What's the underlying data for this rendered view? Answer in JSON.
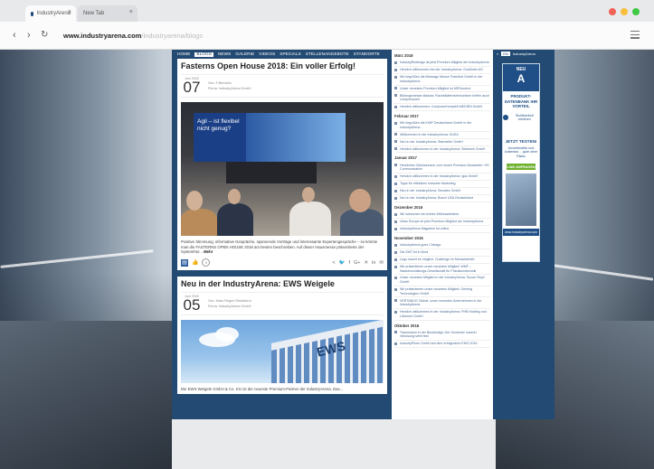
{
  "browser": {
    "tabs": [
      {
        "label": "IndustryArena"
      },
      {
        "label": "New Tab"
      }
    ],
    "tab_close_glyph": "×",
    "window_buttons": [
      {
        "name": "close",
        "color": "#f26155"
      },
      {
        "name": "minimize",
        "color": "#f9be3a"
      },
      {
        "name": "maximize",
        "color": "#3ec945"
      }
    ],
    "nav": {
      "back": "‹",
      "forward": "›",
      "reload": "↻"
    },
    "url_host": "www.industryarena.com",
    "url_path": "/industryarena/blogs",
    "menu_icon": "hamburger-menu-icon"
  },
  "site_nav": [
    "HOME",
    "BLOGS",
    "NEWS",
    "GALERIE",
    "VIDEOS",
    "SPECIALS",
    "STELLENANGEBOTE",
    "STANDORTE"
  ],
  "site_nav_active": "BLOGS",
  "posts": [
    {
      "title": "Fasterns Open House 2018: Ein voller Erfolg!",
      "month": "Juni 2018",
      "day": "07",
      "author": "Von: F.Bertoldo",
      "company": "Firma: IndustryArena GmbH",
      "slide_text": "Agil – ist flexibel nicht genug?",
      "excerpt": "Positive Stimmung, informative Gespräche, spannende Vorträge und interessante Expertengespräche – so könnte man die FASTERNS OPEN HOUSE 2018 am besten beschreiben. Auf dieser Hausmesse präsentierte der Systemher...",
      "more": "Mehr"
    },
    {
      "title": "Neu in der IndustryArena: EWS Weigele",
      "month": "Juni 2018",
      "day": "05",
      "author": "Von: Mark Regen Redakteur",
      "company": "Firma: IndustryArena GmbH",
      "image_text": "EWS",
      "excerpt": "Die EWS Weigele GmbH & Co. KG ist der neueste Premium-Partner der IndustryArena. Das..."
    }
  ],
  "share_icons": [
    "share-icon",
    "twitter-icon",
    "facebook-icon",
    "google-plus-icon",
    "xing-icon",
    "linkedin-icon",
    "email-icon"
  ],
  "share_glyphs": [
    "<",
    "🐦",
    "f",
    "G+",
    "✕",
    "in",
    "✉"
  ],
  "post_action_glyphs": {
    "comment": "▤",
    "like": "👍",
    "comment_count": "0"
  },
  "archive": [
    {
      "month": "März 2018",
      "items": [
        "IndustryRedesign ist jetzt Premium-Mitglied der IndustryArena",
        "Herzlich willkommen bei der IndustryArena: Goldhofer AG",
        "Wir begrüßen die Messago Messe Frankfurt GmbH in der IndustryArena",
        "Unser neuestes Premium-Mitglied ist MEScontrol",
        "Bildungsmesse didacta: Flachbildfernsehmonitore helfen auch Lehrpersonen",
        "Herzlich willkommen: ComputerKomplett MEDIEN GmbH"
      ]
    },
    {
      "month": "Februar 2017",
      "items": [
        "Wir begrüßen die KNIP Deutschland GmbH in der IndustryArena",
        "Willkommen in der IndustryArena: KUKA",
        "Neu in der IndustryArena: Starrseiler GmbH",
        "Herzlich willkommen in der IndustryArena: Steinbeis GmbH"
      ]
    },
    {
      "month": "Januar 2017",
      "items": [
        "Herzliches Glückwunsch zum neuen Premium-Newsletter: HS Communication",
        "Herzlich willkommen in der IndustryArena: igus GmbH",
        "Tipps für effektives Industrie Marketing",
        "Neu in der IndustryArena: Sensitec GmbH",
        "Neu in der IndustryArena: Bosch USA Deutschland"
      ]
    },
    {
      "month": "Dezember 2016",
      "items": [
        "Wir wünschen ein frohes Weihnachtsfest",
        "Ulvac Europe ist jetzt Premium-Mitglied der IndustryArena",
        "IndustryArena-Magazine ist online"
      ]
    },
    {
      "month": "November 2016",
      "items": [
        "IndustryArena goes Chicago",
        "Die DMT ist in Bord",
        "Lego macht es möglich: Challenge im Messebetrieb",
        "Wir präsentieren unser neuestes Mitglied: WMF – Wasserschaltungs-Gesellschaft für Präzisionstechnik",
        "Unser neuestes Mitglied in der IndustryArena: Suzan Reyd GmbH",
        "Wir präsentieren unser neuestes Mitglied: Gehring Technologies GmbH",
        "VERTABLIG Global: unser neuestes Unternehmen in der IndustryArena",
        "Herzlich willkommen in der IndustryArena: PHB Holding und Lütrenen GmbH"
      ]
    },
    {
      "month": "Oktober 2016",
      "items": [
        "Traumsalon in der Bundesliga: Der Gewinner unserer Verlosung steht fest",
        "IndustryPhoto GmbH auf dem erfolgreiche EMO 2016"
      ]
    }
  ],
  "ad_top": {
    "label": "EN",
    "brand": "IndustryArena"
  },
  "ad": {
    "logo_top": "NEU",
    "logo_mark": "A",
    "title": "PRODUKT-DATENBANK IHR VORTEIL",
    "check": "Sichtbarkeit erhöhen",
    "cta_title": "JETZT TESTEN!",
    "cta_sub": "Unverbindlich und kostenlos ... gute ohne Risiko",
    "button": "LINK ANFRAGEN",
    "foot": "www.industryarena.com"
  }
}
